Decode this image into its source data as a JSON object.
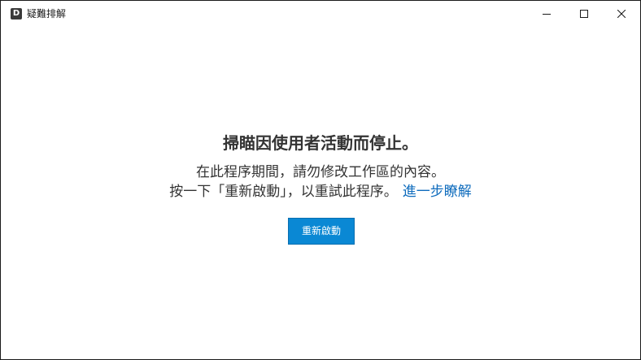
{
  "window": {
    "title": "疑難排解",
    "app_icon_letter": "D",
    "controls": {
      "minimize": "minimize-icon",
      "maximize": "maximize-icon",
      "close": "close-icon"
    }
  },
  "main": {
    "heading": "掃瞄因使用者活動而停止。",
    "description_line1": "在此程序期間，請勿修改工作區的內容。",
    "description_line2": "按一下「重新啟動」，以重試此程序。",
    "learn_more_link": "進一步瞭解",
    "restart_button": "重新啟動"
  },
  "colors": {
    "accent": "#0a88d4",
    "link": "#0f6cbd",
    "text": "#333333"
  }
}
